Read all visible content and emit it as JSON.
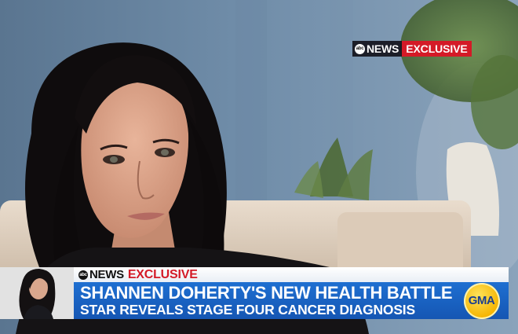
{
  "top_bug": {
    "network": "NEWS",
    "abc_mark": "abc",
    "label": "EXCLUSIVE"
  },
  "lower_third": {
    "network": "NEWS",
    "abc_mark": "abc",
    "tag": "EXCLUSIVE",
    "headline": "SHANNEN DOHERTY'S NEW HEALTH BATTLE",
    "subhead": "STAR REVEALS STAGE FOUR CANCER DIAGNOSIS",
    "show_logo": "GMA"
  },
  "colors": {
    "exclusive_red": "#d41a27",
    "banner_blue": "#1e6fd1",
    "gma_yellow": "#f5b400"
  }
}
